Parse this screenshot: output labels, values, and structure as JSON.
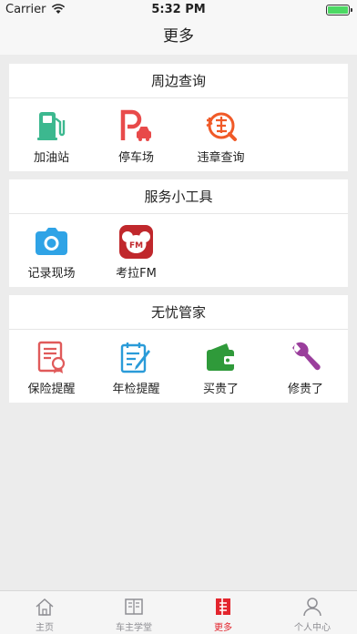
{
  "status_bar": {
    "carrier": "Carrier",
    "time": "5:32 PM"
  },
  "nav": {
    "title": "更多"
  },
  "sections": [
    {
      "title": "周边查询",
      "items": [
        {
          "label": "加油站",
          "icon": "gas-station-icon"
        },
        {
          "label": "停车场",
          "icon": "parking-icon"
        },
        {
          "label": "违章查询",
          "icon": "violation-query-icon"
        }
      ]
    },
    {
      "title": "服务小工具",
      "items": [
        {
          "label": "记录现场",
          "icon": "camera-icon"
        },
        {
          "label": "考拉FM",
          "icon": "koala-fm-icon"
        }
      ]
    },
    {
      "title": "无忧管家",
      "items": [
        {
          "label": "保险提醒",
          "icon": "insurance-reminder-icon"
        },
        {
          "label": "年检提醒",
          "icon": "inspection-reminder-icon"
        },
        {
          "label": "买贵了",
          "icon": "wallet-icon"
        },
        {
          "label": "修贵了",
          "icon": "wrench-icon"
        }
      ]
    }
  ],
  "tabs": [
    {
      "label": "主页",
      "icon": "home-icon"
    },
    {
      "label": "车主学堂",
      "icon": "book-icon"
    },
    {
      "label": "更多",
      "icon": "more-icon",
      "active": true
    },
    {
      "label": "个人中心",
      "icon": "profile-icon"
    }
  ],
  "colors": {
    "accent": "#e3252d",
    "gas_green": "#3cb88f",
    "parking_red": "#e84a4a",
    "violation_orange": "#f05a28",
    "camera_blue": "#2fa3e6",
    "koala_red": "#c0282c",
    "insurance_red": "#e05a5a",
    "inspection_blue": "#2a9bd8",
    "wallet_green": "#2f9a3a",
    "wrench_purple": "#9a3e9c"
  }
}
